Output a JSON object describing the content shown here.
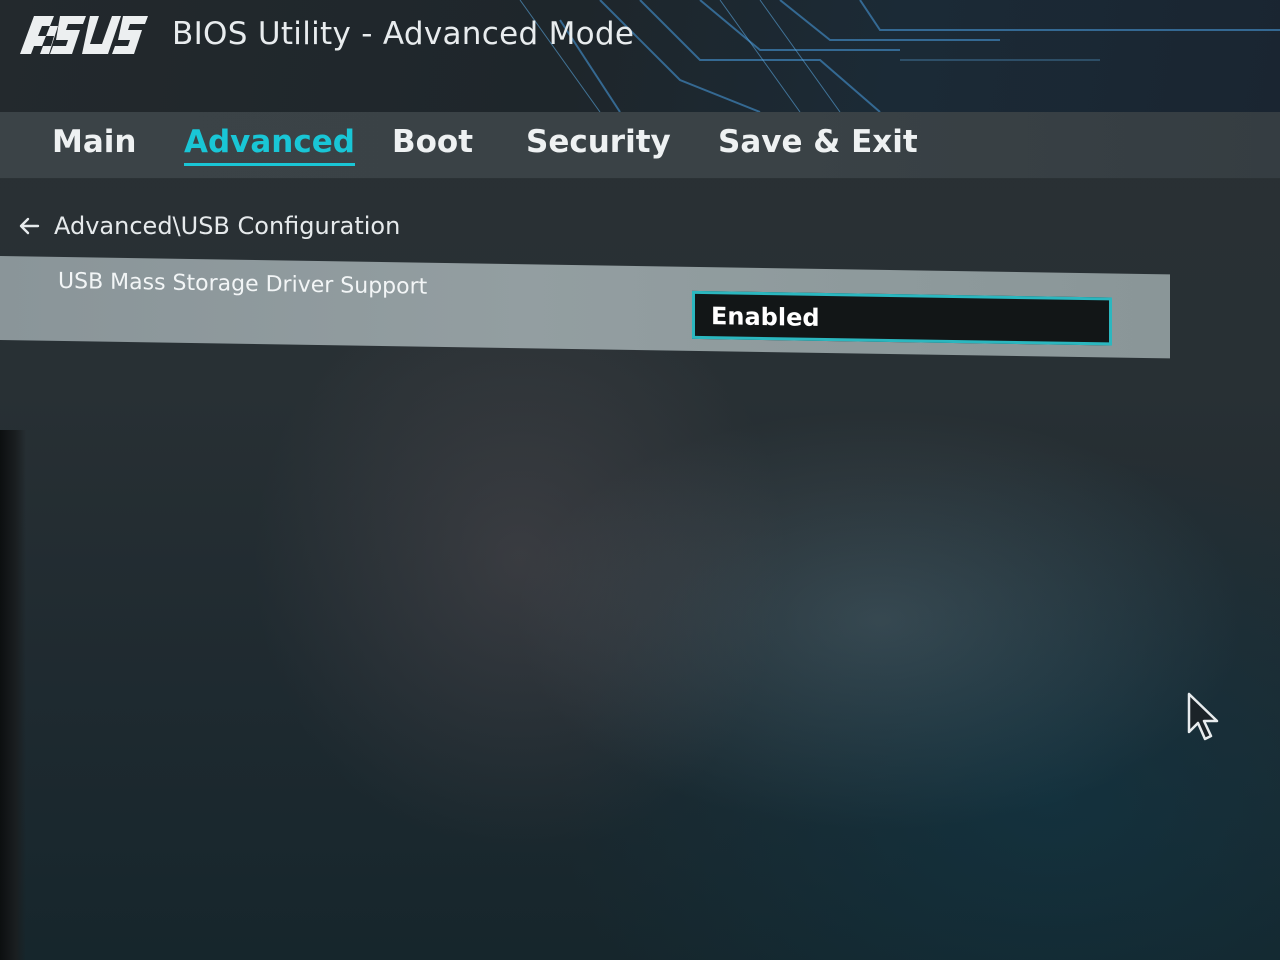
{
  "window": {
    "brand": "ASUS",
    "title": "BIOS Utility - Advanced Mode"
  },
  "tabs": [
    {
      "label": "Main",
      "active": false
    },
    {
      "label": "Advanced",
      "active": true
    },
    {
      "label": "Boot",
      "active": false
    },
    {
      "label": "Security",
      "active": false
    },
    {
      "label": "Save & Exit",
      "active": false
    }
  ],
  "breadcrumb": {
    "back_icon": "arrow-left-icon",
    "path": "Advanced\\USB Configuration"
  },
  "settings": [
    {
      "label": "USB Mass Storage Driver Support",
      "value": "Enabled"
    }
  ],
  "colors": {
    "accent": "#19c6d6",
    "value_border": "#2bb7bf",
    "selected_row": "#939ea1"
  },
  "icons": {
    "pointer": "mouse-pointer-icon"
  }
}
